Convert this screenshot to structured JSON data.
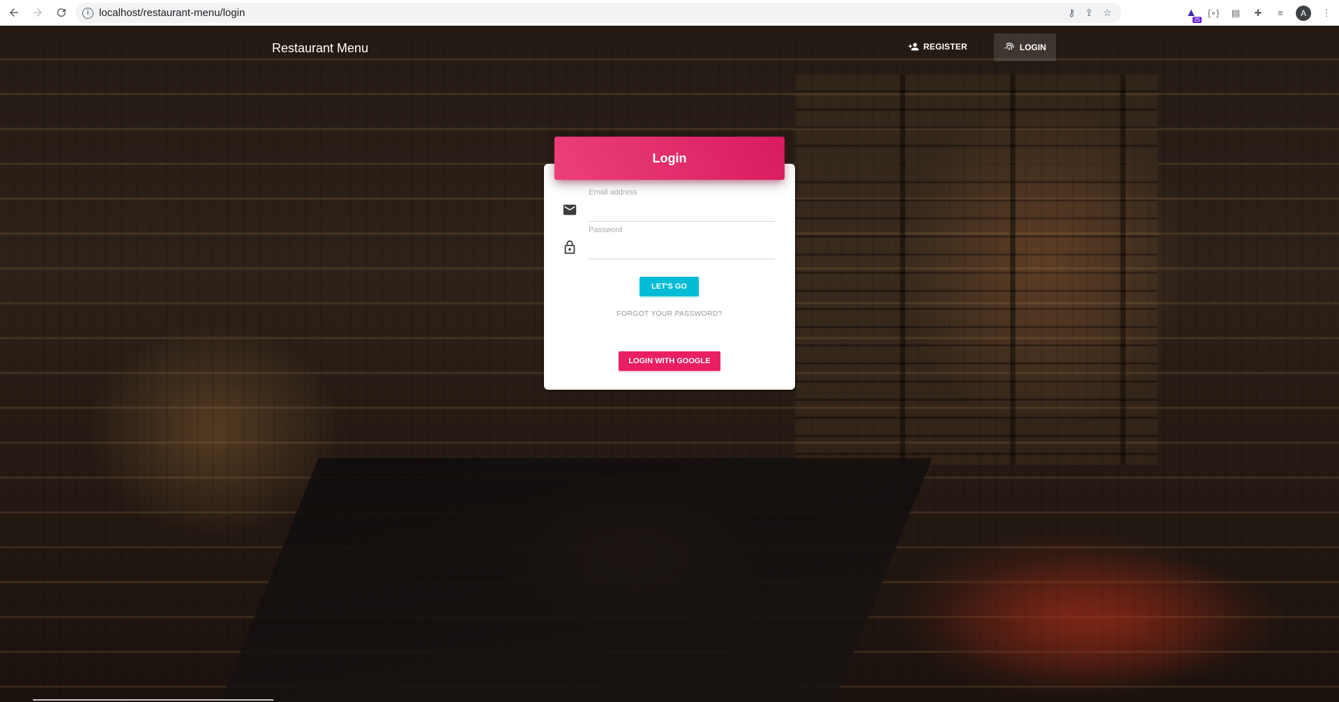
{
  "browser": {
    "url": "localhost/restaurant-menu/login",
    "extension_badge": "25",
    "profile_initial": "A"
  },
  "nav": {
    "brand": "Restaurant Menu",
    "register_label": "REGISTER",
    "login_label": "LOGIN"
  },
  "login_card": {
    "title": "Login",
    "email_label": "Email address",
    "email_value": "",
    "password_label": "Password",
    "password_value": "",
    "submit_label": "LET'S GO",
    "forgot_label": "FORGOT YOUR PASSWORD?",
    "google_label": "LOGIN WITH GOOGLE"
  },
  "colors": {
    "header_gradient_start": "#ec407a",
    "header_gradient_end": "#d81b60",
    "primary_button": "#00bcd4",
    "google_button": "#e91e63"
  },
  "icons": {
    "email_field": "mail-icon",
    "password_field": "lock-icon",
    "register": "person-add-icon",
    "login": "fingerprint-icon"
  }
}
